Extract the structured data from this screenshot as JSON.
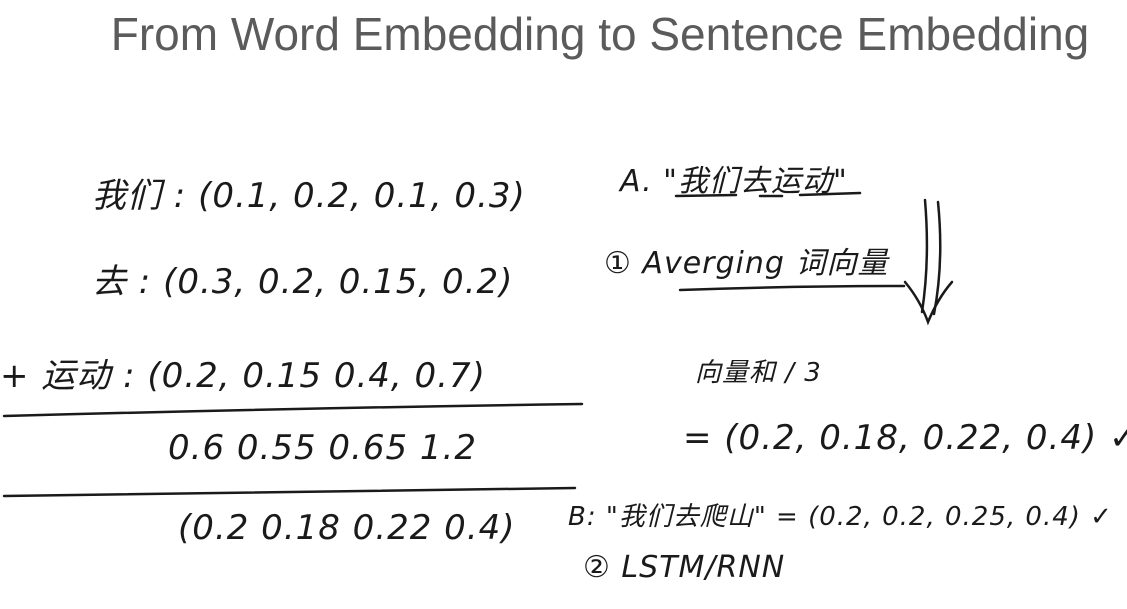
{
  "slide": {
    "title": "From Word Embedding to Sentence Embedding"
  },
  "left_calc": {
    "line1": "我们 : (0.1, 0.2, 0.1, 0.3)",
    "line2": "去 : (0.3, 0.2, 0.15, 0.2)",
    "line3": "+ 运动 : (0.2, 0.15 0.4, 0.7)",
    "sum": "0.6 0.55 0.65 1.2",
    "average": "(0.2 0.18 0.22 0.4)"
  },
  "right_notes": {
    "sentence_a": "A. \"我们去运动\"",
    "method1": "① Averging 词向量",
    "vector_sum_over_3": "向量和 / 3",
    "result_a": "= (0.2, 0.18, 0.22, 0.4) ✓",
    "sentence_b": "B: \"我们去爬山\" = (0.2, 0.2, 0.25, 0.4) ✓",
    "method2": "② LSTM/RNN"
  }
}
